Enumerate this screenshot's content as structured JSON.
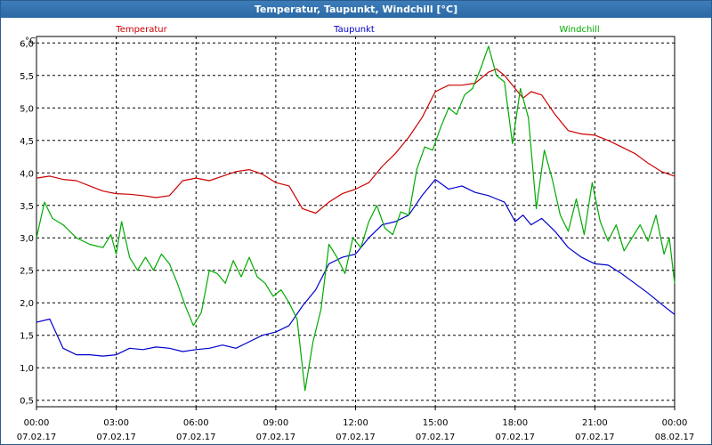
{
  "window": {
    "title": "Temperatur, Taupunkt, Windchill [°C]"
  },
  "chart_data": {
    "type": "line",
    "title": "Temperatur, Taupunkt, Windchill [°C]",
    "ylabel": "°C",
    "xlabel": "",
    "ylim": [
      0.4,
      6.1
    ],
    "xlim_hours": [
      0,
      24
    ],
    "grid": true,
    "yticks": [
      "6,0",
      "5,5",
      "5,0",
      "4,5",
      "4,0",
      "3,5",
      "3,0",
      "2,5",
      "2,0",
      "1,5",
      "1,0",
      "0,5"
    ],
    "ytick_values": [
      6.0,
      5.5,
      5.0,
      4.5,
      4.0,
      3.5,
      3.0,
      2.5,
      2.0,
      1.5,
      1.0,
      0.5
    ],
    "xticks": [
      {
        "time": "00:00",
        "date": "07.02.17"
      },
      {
        "time": "03:00",
        "date": "07.02.17"
      },
      {
        "time": "06:00",
        "date": "07.02.17"
      },
      {
        "time": "09:00",
        "date": "07.02.17"
      },
      {
        "time": "12:00",
        "date": "07.02.17"
      },
      {
        "time": "15:00",
        "date": "07.02.17"
      },
      {
        "time": "18:00",
        "date": "07.02.17"
      },
      {
        "time": "21:00",
        "date": "07.02.17"
      },
      {
        "time": "00:00",
        "date": "08.02.17"
      }
    ],
    "series": [
      {
        "name": "Temperatur",
        "color": "#cc0000",
        "x": [
          0,
          0.5,
          1,
          1.5,
          2,
          2.5,
          3,
          3.5,
          4,
          4.5,
          5,
          5.5,
          6,
          6.5,
          7,
          7.5,
          8,
          8.5,
          9,
          9.5,
          10,
          10.5,
          11,
          11.5,
          12,
          12.5,
          13,
          13.5,
          14,
          14.5,
          15,
          15.5,
          16,
          16.5,
          17,
          17.3,
          17.6,
          18,
          18.3,
          18.6,
          19,
          19.5,
          20,
          20.5,
          21,
          21.5,
          22,
          22.5,
          23,
          23.5,
          24
        ],
        "values": [
          3.92,
          3.95,
          3.9,
          3.88,
          3.8,
          3.72,
          3.68,
          3.67,
          3.65,
          3.62,
          3.65,
          3.88,
          3.92,
          3.88,
          3.95,
          4.02,
          4.05,
          3.98,
          3.85,
          3.8,
          3.45,
          3.38,
          3.55,
          3.68,
          3.75,
          3.85,
          4.1,
          4.3,
          4.55,
          4.85,
          5.25,
          5.35,
          5.35,
          5.38,
          5.55,
          5.6,
          5.5,
          5.3,
          5.15,
          5.25,
          5.2,
          4.9,
          4.65,
          4.6,
          4.58,
          4.5,
          4.4,
          4.3,
          4.15,
          4.02,
          3.95
        ]
      },
      {
        "name": "Taupunkt",
        "color": "#0000cc",
        "x": [
          0,
          0.5,
          1,
          1.5,
          2,
          2.5,
          3,
          3.5,
          4,
          4.5,
          5,
          5.5,
          6,
          6.5,
          7,
          7.5,
          8,
          8.5,
          9,
          9.5,
          10,
          10.5,
          11,
          11.5,
          12,
          12.5,
          13,
          13.5,
          14,
          14.5,
          15,
          15.5,
          16,
          16.5,
          17,
          17.3,
          17.6,
          18,
          18.3,
          18.6,
          19,
          19.5,
          20,
          20.5,
          21,
          21.5,
          22,
          22.5,
          23,
          23.5,
          24
        ],
        "values": [
          1.7,
          1.75,
          1.3,
          1.2,
          1.2,
          1.18,
          1.2,
          1.3,
          1.28,
          1.32,
          1.3,
          1.25,
          1.28,
          1.3,
          1.35,
          1.3,
          1.4,
          1.5,
          1.55,
          1.65,
          1.95,
          2.2,
          2.6,
          2.7,
          2.75,
          3.0,
          3.2,
          3.25,
          3.35,
          3.65,
          3.9,
          3.75,
          3.8,
          3.7,
          3.65,
          3.6,
          3.55,
          3.25,
          3.35,
          3.2,
          3.3,
          3.1,
          2.85,
          2.7,
          2.6,
          2.58,
          2.45,
          2.3,
          2.15,
          1.98,
          1.82
        ]
      },
      {
        "name": "Windchill",
        "color": "#00aa00",
        "x": [
          0,
          0.3,
          0.6,
          1,
          1.5,
          2,
          2.5,
          2.8,
          3,
          3.2,
          3.5,
          3.8,
          4.1,
          4.4,
          4.7,
          5,
          5.3,
          5.6,
          5.9,
          6.2,
          6.5,
          6.8,
          7.1,
          7.4,
          7.7,
          8,
          8.3,
          8.6,
          8.9,
          9.2,
          9.5,
          9.8,
          10.1,
          10.4,
          10.7,
          11,
          11.3,
          11.6,
          11.9,
          12.2,
          12.5,
          12.8,
          13.1,
          13.4,
          13.7,
          14,
          14.3,
          14.6,
          14.9,
          15.2,
          15.5,
          15.8,
          16.1,
          16.4,
          16.7,
          17,
          17.3,
          17.6,
          17.9,
          18.2,
          18.5,
          18.8,
          19.1,
          19.4,
          19.7,
          20,
          20.3,
          20.6,
          20.9,
          21.2,
          21.5,
          21.8,
          22.1,
          22.4,
          22.7,
          23,
          23.3,
          23.6,
          23.8,
          24
        ],
        "values": [
          3.0,
          3.55,
          3.3,
          3.2,
          3.0,
          2.9,
          2.85,
          3.05,
          2.75,
          3.25,
          2.7,
          2.5,
          2.7,
          2.5,
          2.75,
          2.6,
          2.3,
          1.95,
          1.65,
          1.85,
          2.5,
          2.45,
          2.3,
          2.65,
          2.4,
          2.7,
          2.4,
          2.3,
          2.1,
          2.2,
          2.0,
          1.75,
          0.65,
          1.4,
          1.9,
          2.9,
          2.7,
          2.45,
          3.0,
          2.85,
          3.25,
          3.5,
          3.15,
          3.05,
          3.4,
          3.35,
          4.05,
          4.4,
          4.35,
          4.7,
          5.0,
          4.9,
          5.2,
          5.3,
          5.6,
          5.95,
          5.5,
          5.4,
          4.45,
          5.3,
          4.85,
          3.45,
          4.35,
          3.9,
          3.35,
          3.1,
          3.6,
          3.05,
          3.85,
          3.25,
          2.95,
          3.2,
          2.8,
          3.0,
          3.2,
          2.95,
          3.35,
          2.75,
          3.0,
          2.3
        ]
      }
    ]
  }
}
